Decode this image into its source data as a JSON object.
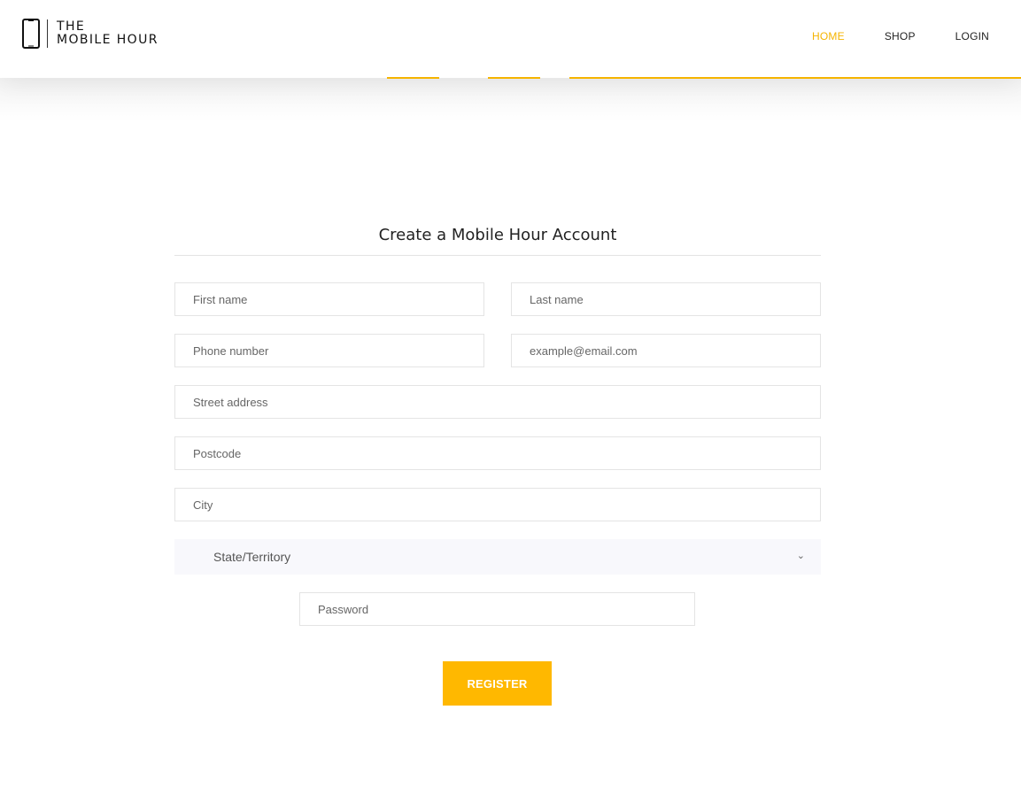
{
  "header": {
    "logo": {
      "line1": "THE",
      "line2": "MOBILE HOUR",
      "icon": "phone-icon"
    },
    "nav": [
      {
        "label": "HOME"
      },
      {
        "label": "SHOP"
      },
      {
        "label": "LOGIN"
      }
    ],
    "accent_color": "#f5b400"
  },
  "form": {
    "title": "Create a Mobile Hour Account",
    "first_name_placeholder": "First name",
    "last_name_placeholder": "Last name",
    "phone_placeholder": "Phone number",
    "email_placeholder": "example@email.com",
    "street_placeholder": "Street address",
    "postcode_placeholder": "Postcode",
    "city_placeholder": "City",
    "state_select": "State/Territory",
    "password_placeholder": "Password",
    "register_label": "REGISTER",
    "button_color": "#ffb800"
  }
}
